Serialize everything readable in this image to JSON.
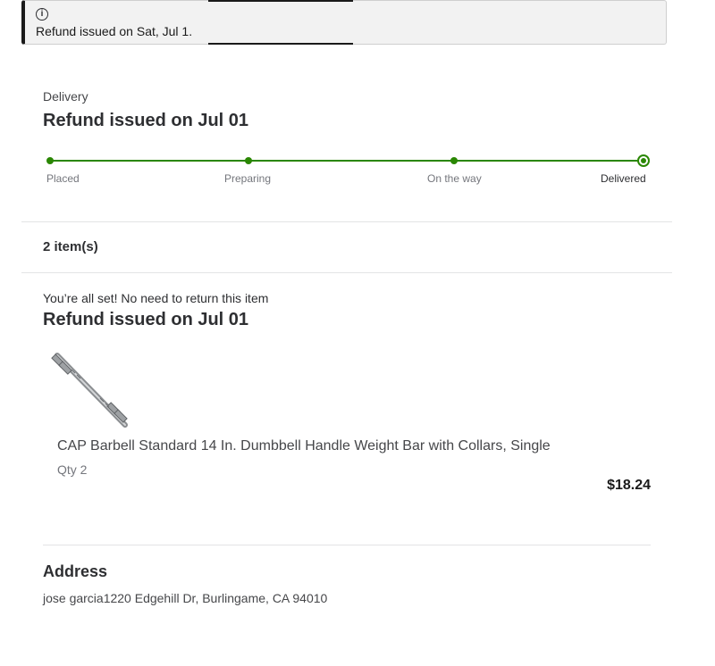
{
  "banner": {
    "icon": "info-icon",
    "text": "Refund issued on Sat, Jul 1."
  },
  "delivery": {
    "label": "Delivery",
    "title": "Refund issued on Jul 01",
    "progress_color": "#2a8703",
    "steps": [
      {
        "label": "Placed",
        "complete": true
      },
      {
        "label": "Preparing",
        "complete": true
      },
      {
        "label": "On the way",
        "complete": true
      },
      {
        "label": "Delivered",
        "complete": true,
        "current": true
      }
    ]
  },
  "items": {
    "count_label": "2 item(s)"
  },
  "return": {
    "note": "You’re all set! No need to return this item",
    "title": "Refund issued on Jul 01"
  },
  "product": {
    "image_icon": "dumbbell-handle-image",
    "name": "CAP Barbell Standard 14 In. Dumbbell Handle Weight Bar with Collars, Single",
    "qty": "Qty 2",
    "price": "$18.24"
  },
  "address": {
    "title": "Address",
    "text": "jose garcia1220 Edgehill Dr, Burlingame, CA 94010"
  }
}
